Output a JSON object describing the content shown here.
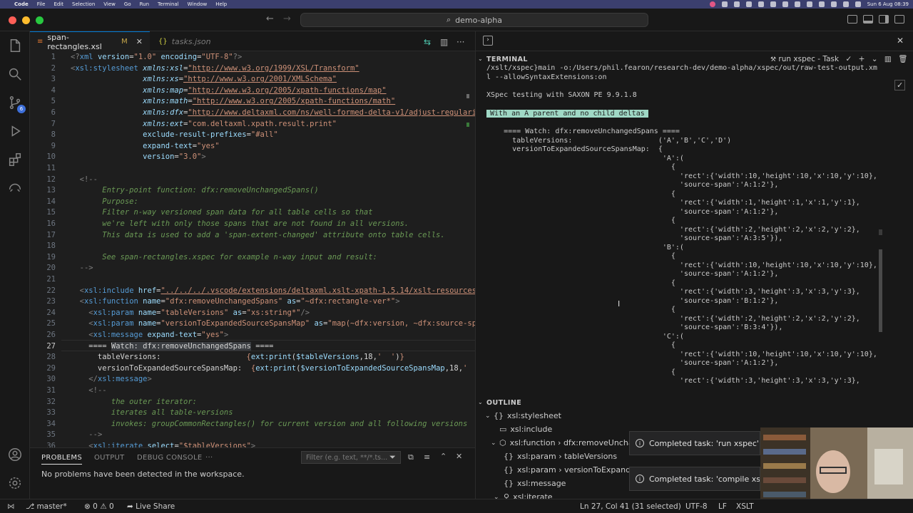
{
  "menubar": {
    "app": "Code",
    "items": [
      "File",
      "Edit",
      "Selection",
      "View",
      "Go",
      "Run",
      "Terminal",
      "Window",
      "Help"
    ],
    "datetime": "Sun 6 Aug 08:39"
  },
  "titlebar": {
    "search": "demo-alpha"
  },
  "tabs": [
    {
      "label": "span-rectangles.xsl",
      "modified": "M"
    },
    {
      "label": "tasks.json"
    }
  ],
  "editor": {
    "line_numbers": [
      "1",
      "2",
      "3",
      "4",
      "5",
      "6",
      "7",
      "8",
      "9",
      "10",
      "11",
      "12",
      "13",
      "14",
      "15",
      "16",
      "17",
      "18",
      "19",
      "20",
      "21",
      "22",
      "23",
      "24",
      "25",
      "26",
      "27",
      "28",
      "29",
      "30",
      "31",
      "32",
      "33",
      "34",
      "35",
      "36"
    ]
  },
  "panel": {
    "tabs": [
      "PROBLEMS",
      "OUTPUT",
      "DEBUG CONSOLE"
    ],
    "more": "···",
    "filter_placeholder": "Filter (e.g. text, **/*.ts...",
    "message": "No problems have been detected in the workspace."
  },
  "terminal": {
    "header": "TERMINAL",
    "task": "run xspec - Task",
    "lines": [
      "/xslt/xspec}main -o:/Users/phil.fearon/research-dev/demo-alpha/xspec/out/raw-test-output.xm",
      "l --allowSyntaxExtensions:on",
      "",
      "XSpec testing with SAXON PE 9.9.1.8",
      "",
      "With an A parent and no child deltas",
      "",
      "    ==== Watch: dfx:removeUnchangedSpans ====",
      "      tableVersions:                    ('A','B','C','D')",
      "      versionToExpandedSourceSpansMap:  {",
      "                                         'A':(",
      "                                           {",
      "                                             'rect':{'width':10,'height':10,'x':10,'y':10},",
      "                                             'source-span':'A:1:2'},",
      "                                           {",
      "                                             'rect':{'width':1,'height':1,'x':1,'y':1},",
      "                                             'source-span':'A:1:2'},",
      "                                           {",
      "                                             'rect':{'width':2,'height':2,'x':2,'y':2},",
      "                                             'source-span':'A:3:5'}),",
      "                                         'B':(",
      "                                           {",
      "                                             'rect':{'width':10,'height':10,'x':10,'y':10},",
      "                                             'source-span':'A:1:2'},",
      "                                           {",
      "                                             'rect':{'width':3,'height':3,'x':3,'y':3},",
      "                                             'source-span':'B:1:2'},",
      "                                           {",
      "                                             'rect':{'width':2,'height':2,'x':2,'y':2},",
      "                                             'source-span':'B:3:4'}),",
      "                                         'C':(",
      "                                           {",
      "                                             'rect':{'width':10,'height':10,'x':10,'y':10},",
      "                                             'source-span':'A:1:2'},",
      "                                           {",
      "                                             'rect':{'width':3,'height':3,'x':3,'y':3},"
    ]
  },
  "outline": {
    "header": "OUTLINE",
    "items": [
      "xsl:stylesheet",
      "xsl:include",
      "xsl:function › dfx:removeUnchan",
      "xsl:param › tableVersions",
      "xsl:param › versionToExpande",
      "xsl:message",
      "xsl:iterate"
    ]
  },
  "notifications": [
    "Completed task: 'run xspec'",
    "Completed task: 'compile xspe"
  ],
  "statusbar": {
    "branch": "master*",
    "errors": "0",
    "warnings": "0",
    "liveshare": "Live Share",
    "position": "Ln 27, Col 41 (31 selected)",
    "encoding": "UTF-8",
    "eol": "LF",
    "language": "XSLT"
  },
  "colors": {
    "accent": "#0078d4",
    "badge": "#3d6fd9",
    "terminal_highlight": "#9fd8c5"
  }
}
